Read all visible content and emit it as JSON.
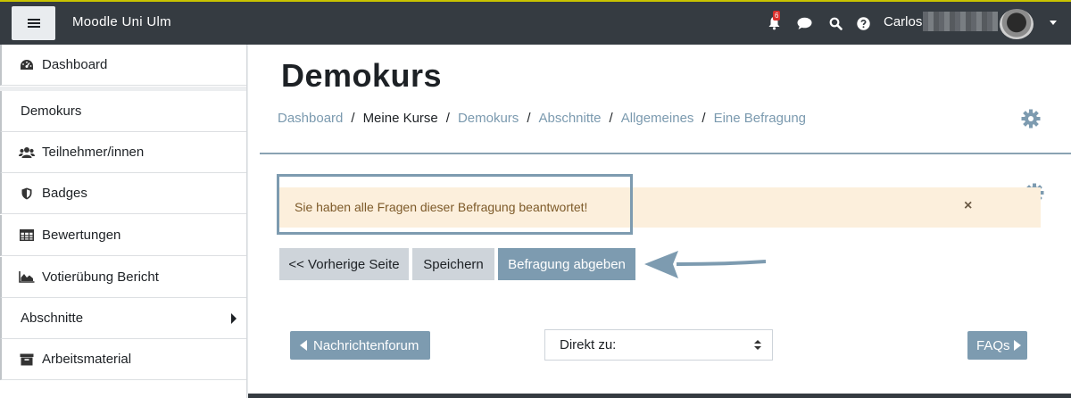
{
  "navbar": {
    "brand": "Moodle Uni Ulm",
    "notification_count": "6",
    "username": "Carlos",
    "icons": [
      "menu-icon",
      "bell-icon",
      "chat-icon",
      "search-icon",
      "help-icon",
      "chevron-down-icon"
    ]
  },
  "sidebar": {
    "items": [
      {
        "label": "Dashboard",
        "icon": "dashboard-icon"
      },
      {
        "label": "Demokurs",
        "icon": ""
      },
      {
        "label": "Teilnehmer/innen",
        "icon": "users-icon"
      },
      {
        "label": "Badges",
        "icon": "shield-icon"
      },
      {
        "label": "Bewertungen",
        "icon": "table-icon"
      },
      {
        "label": "Votierübung Bericht",
        "icon": "area-chart-icon"
      },
      {
        "label": "Abschnitte",
        "icon": "chevron-right-icon"
      },
      {
        "label": "Arbeitsmaterial",
        "icon": "archive-icon"
      }
    ]
  },
  "main": {
    "title": "Demokurs",
    "breadcrumb": [
      {
        "label": "Dashboard"
      },
      {
        "label": "Meine Kurse"
      },
      {
        "label": "Demokurs"
      },
      {
        "label": "Abschnitte"
      },
      {
        "label": "Allgemeines"
      },
      {
        "label": "Eine Befragung"
      }
    ],
    "breadcrumb_separator": "/",
    "alert": {
      "text": "Sie haben alle Fragen dieser Befragung beantwortet!",
      "close": "×"
    },
    "buttons": {
      "previous": "<< Vorherige Seite",
      "save": "Speichern",
      "submit": "Befragung abgeben"
    },
    "activity_nav": {
      "prev": "Nachrichtenforum",
      "jump_placeholder": "Direkt zu:",
      "next": "FAQs"
    }
  },
  "colors": {
    "navbar": "#353b41",
    "accent": "#7d9bb0",
    "alert_bg": "#fcefdc",
    "alert_text": "#7d5a29",
    "badge": "#d9302c"
  }
}
